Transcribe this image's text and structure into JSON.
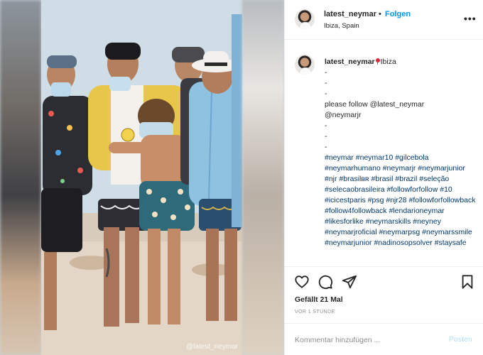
{
  "post": {
    "username": "latest_neymar",
    "follow_label": "Folgen",
    "dot": "•",
    "location": "Ibiza, Spain",
    "more_label": "•••",
    "watermark": "@latest_neymar"
  },
  "caption": {
    "username": "latest_neymar",
    "location_text": "Ibiza",
    "lines": [
      "-",
      "-",
      "-"
    ],
    "follow_line_1": "please follow @latest_neymar",
    "follow_line_2": "@neymarjr",
    "lines_after": [
      "-",
      "-",
      "-"
    ],
    "hashtags": "#neymar #neymar10 #gilcebola #neymarhumano #neymarjr #neymarjunior #njr #brasilʙʀ #brasil #brazil #seleção #selecaobrasileira #followforfollow #10 #icicestparis #psg #njr28 #followforfollowback #follow4followback #lendarioneymar #likesforlike #neymarskills #neyney #neymarjroficial #neymarpsg #neymarssmile #neymarjunior #nadinosopsolver #staysafe"
  },
  "actions": {
    "like_icon": "heart-icon",
    "comment_icon": "comment-icon",
    "share_icon": "send-icon",
    "save_icon": "bookmark-icon",
    "likes_text": "Gefällt 21 Mal",
    "time_text": "VOR 1 STUNDE"
  },
  "comment": {
    "placeholder": "Kommentar hinzufügen ...",
    "post_label": "Posten"
  },
  "colors": {
    "accent": "#0095f6",
    "hashtag": "#00376b",
    "muted": "#8e8e8e",
    "post_disabled": "#b2dffc"
  }
}
